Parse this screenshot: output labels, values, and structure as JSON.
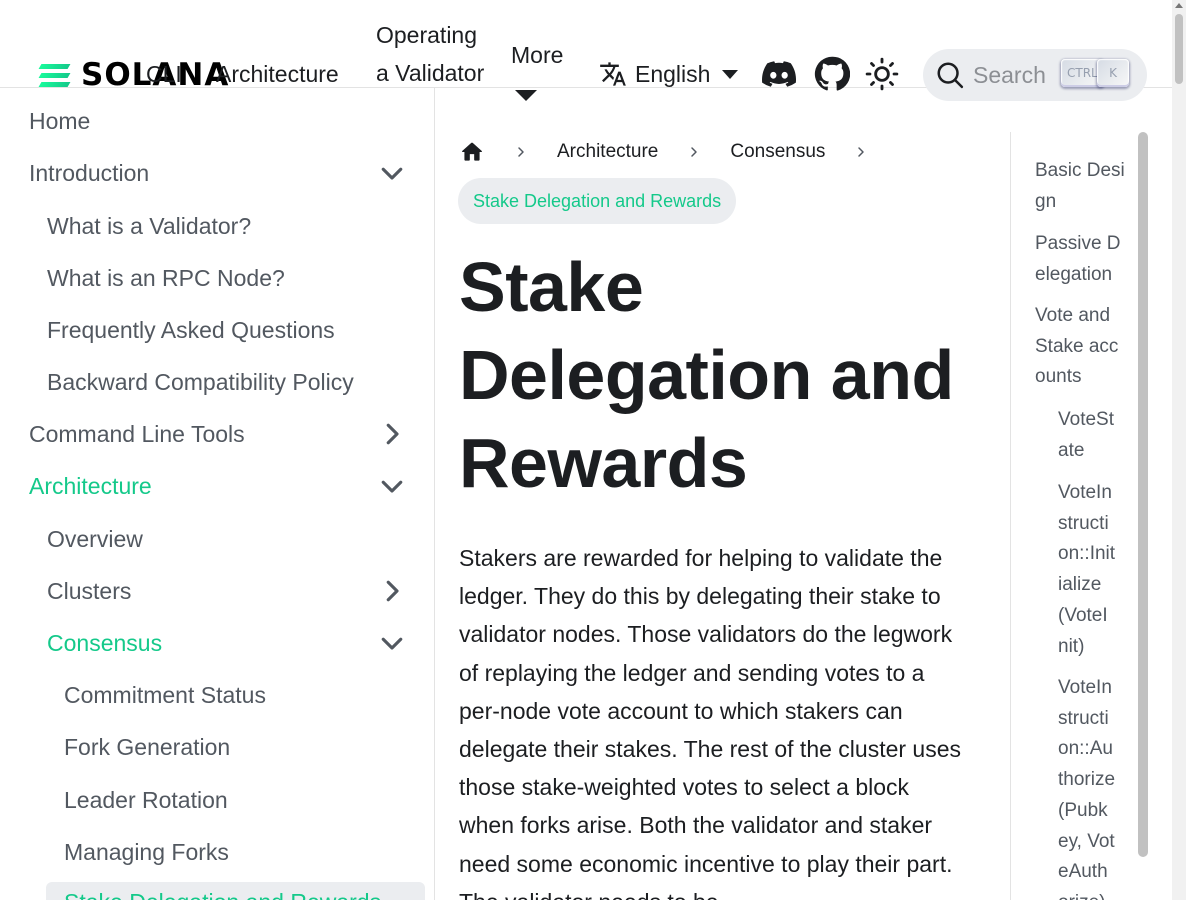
{
  "navbar": {
    "logo_text": "SOLANA",
    "links": {
      "cli": "CLI",
      "architecture": "Architecture",
      "operating": "Operating a Validator",
      "more": "More"
    },
    "language": "English",
    "search": {
      "placeholder": "Search",
      "kbd_ctrl": "CTRL",
      "kbd_k": "K"
    },
    "icons": [
      "translate-icon",
      "discord-icon",
      "github-icon",
      "theme-toggle-icon",
      "search-icon"
    ]
  },
  "sidebar": {
    "items": [
      {
        "label": "Home"
      },
      {
        "label": "Introduction",
        "expanded": true
      },
      {
        "label": "What is a Validator?"
      },
      {
        "label": "What is an RPC Node?"
      },
      {
        "label": "Frequently Asked Questions"
      },
      {
        "label": "Backward Compatibility Policy"
      },
      {
        "label": "Command Line Tools",
        "expanded": false
      },
      {
        "label": "Architecture",
        "expanded": true,
        "active": true
      },
      {
        "label": "Overview"
      },
      {
        "label": "Clusters",
        "expanded": false
      },
      {
        "label": "Consensus",
        "expanded": true,
        "active": true
      },
      {
        "label": "Commitment Status"
      },
      {
        "label": "Fork Generation"
      },
      {
        "label": "Leader Rotation"
      },
      {
        "label": "Managing Forks"
      },
      {
        "label": "Stake Delegation and Rewards",
        "current": true
      }
    ]
  },
  "breadcrumbs": {
    "items": [
      "Architecture",
      "Consensus"
    ],
    "current": "Stake Delegation and Rewards"
  },
  "page": {
    "title": "Stake Delegation and Rewards",
    "intro": "Stakers are rewarded for helping to validate the ledger. They do this by delegating their stake to validator nodes. Those validators do the legwork of replaying the ledger and sending votes to a per-node vote account to which stakers can delegate their stakes. The rest of the cluster uses those stake-weighted votes to select a block when forks arise. Both the validator and staker need some economic incentive to play their part. The validator needs to be"
  },
  "toc": {
    "items": [
      {
        "label": "Basic Design",
        "level": 1
      },
      {
        "label": "Passive Delegation",
        "level": 1
      },
      {
        "label": "Vote and Stake accounts",
        "level": 1
      },
      {
        "label": "VoteState",
        "level": 2
      },
      {
        "label": "VoteInstruction::Initialize(VoteInit)",
        "level": 2
      },
      {
        "label": "VoteInstruction::Authorize(Pubkey, VoteAuthorize)",
        "level": 2
      }
    ]
  },
  "colors": {
    "accent": "#14c98a",
    "text": "#1c1e21",
    "muted": "#525860",
    "pill_bg": "#ebedf0"
  }
}
